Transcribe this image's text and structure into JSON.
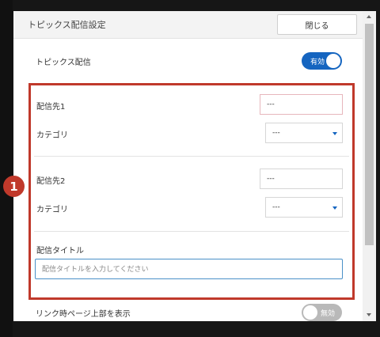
{
  "dialog": {
    "title": "トピックス配信設定",
    "close_label": "閉じる"
  },
  "topics": {
    "label": "トピックス配信",
    "toggle_text": "有効",
    "toggle_state": "on"
  },
  "destinations": [
    {
      "label": "配信先1",
      "value": "---",
      "category_label": "カテゴリ",
      "category_value": "---"
    },
    {
      "label": "配信先2",
      "value": "---",
      "category_label": "カテゴリ",
      "category_value": "---"
    }
  ],
  "distribution_title": {
    "label": "配信タイトル",
    "placeholder": "配信タイトルを入力してください"
  },
  "link_top": {
    "label": "リンク時ページ上部を表示",
    "toggle_text": "無効",
    "toggle_state": "off"
  },
  "annotation": {
    "badge_number": "1"
  },
  "colors": {
    "accent": "#1565c0",
    "highlight": "#c0392b"
  }
}
